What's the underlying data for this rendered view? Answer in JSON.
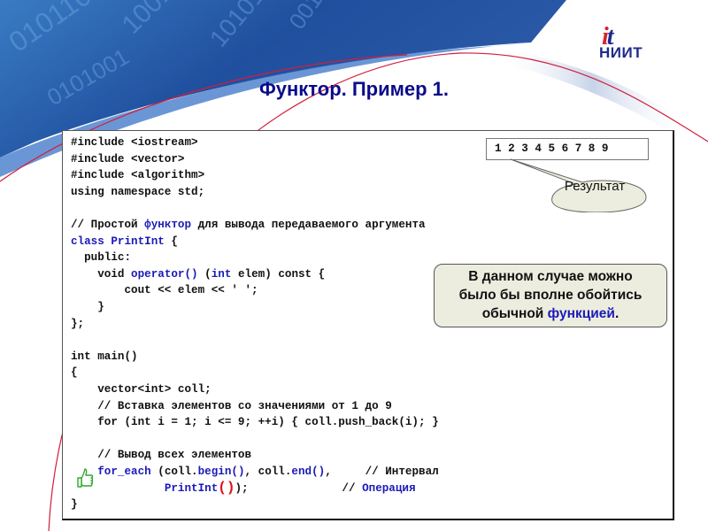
{
  "slide": {
    "title": "Функтор. Пример 1.",
    "logo": {
      "mark_i": "i",
      "mark_t": "t",
      "text": "НИИТ"
    },
    "colors": {
      "title": "#0b0b8a",
      "keyword": "#1a1ab8",
      "accent_red": "#e0101a",
      "banner_blue": "#2a5caa",
      "note_bg": "#ededdf"
    },
    "background_pattern": "binary digits 0 1"
  },
  "code": {
    "lines": [
      {
        "parts": [
          {
            "t": "#include <iostream>",
            "c": ""
          }
        ]
      },
      {
        "parts": [
          {
            "t": "#include <vector>",
            "c": ""
          }
        ]
      },
      {
        "parts": [
          {
            "t": "#include <algorithm>",
            "c": ""
          }
        ]
      },
      {
        "parts": [
          {
            "t": "using namespace std;",
            "c": ""
          }
        ]
      },
      {
        "parts": [
          {
            "t": "",
            "c": ""
          }
        ]
      },
      {
        "parts": [
          {
            "t": "// Простой ",
            "c": ""
          },
          {
            "t": "функтор",
            "c": "kw"
          },
          {
            "t": " для вывода передаваемого аргумента",
            "c": ""
          }
        ]
      },
      {
        "parts": [
          {
            "t": "class PrintInt",
            "c": "kw"
          },
          {
            "t": " {",
            "c": ""
          }
        ]
      },
      {
        "parts": [
          {
            "t": "  public:",
            "c": ""
          }
        ]
      },
      {
        "parts": [
          {
            "t": "    void ",
            "c": ""
          },
          {
            "t": "operator()",
            "c": "kw"
          },
          {
            "t": " (",
            "c": ""
          },
          {
            "t": "int",
            "c": "kw"
          },
          {
            "t": " elem) const {",
            "c": ""
          }
        ]
      },
      {
        "parts": [
          {
            "t": "        cout << elem << ' ';",
            "c": ""
          }
        ]
      },
      {
        "parts": [
          {
            "t": "    }",
            "c": ""
          }
        ]
      },
      {
        "parts": [
          {
            "t": "};",
            "c": ""
          }
        ]
      },
      {
        "parts": [
          {
            "t": "",
            "c": ""
          }
        ]
      },
      {
        "parts": [
          {
            "t": "int main()",
            "c": ""
          }
        ]
      },
      {
        "parts": [
          {
            "t": "{",
            "c": ""
          }
        ]
      },
      {
        "parts": [
          {
            "t": "    vector<int> coll;",
            "c": ""
          }
        ]
      },
      {
        "parts": [
          {
            "t": "    // Вставка элементов со значениями от 1 до 9",
            "c": ""
          }
        ]
      },
      {
        "parts": [
          {
            "t": "    for (int i = 1; i <= 9; ++i) { coll.push_back(i); }",
            "c": ""
          }
        ]
      },
      {
        "parts": [
          {
            "t": "",
            "c": ""
          }
        ]
      },
      {
        "parts": [
          {
            "t": "    // Вывод всех элементов",
            "c": ""
          }
        ]
      },
      {
        "parts": [
          {
            "t": "    ",
            "c": ""
          },
          {
            "t": "for_each",
            "c": "kw"
          },
          {
            "t": " (coll.",
            "c": ""
          },
          {
            "t": "begin()",
            "c": "kw"
          },
          {
            "t": ", coll.",
            "c": ""
          },
          {
            "t": "end()",
            "c": "kw"
          },
          {
            "t": ",     // Интервал",
            "c": ""
          }
        ]
      },
      {
        "parts": [
          {
            "t": "              ",
            "c": ""
          },
          {
            "t": "PrintInt",
            "c": "kw"
          },
          {
            "t": "()",
            "c": "red"
          },
          {
            "t": ");              // ",
            "c": ""
          },
          {
            "t": "Операция",
            "c": "kw"
          }
        ]
      },
      {
        "parts": [
          {
            "t": "}",
            "c": ""
          }
        ]
      }
    ]
  },
  "result": {
    "output": "1 2 3 4 5 6 7 8 9",
    "callout_label": "Результат"
  },
  "note": {
    "line1": "В данном случае можно",
    "line2": "было бы вполне обойтись",
    "line3_prefix": "обычной ",
    "line3_highlight": "функцией",
    "line3_suffix": "."
  },
  "icons": {
    "thumb": "thumbs-up-icon"
  }
}
